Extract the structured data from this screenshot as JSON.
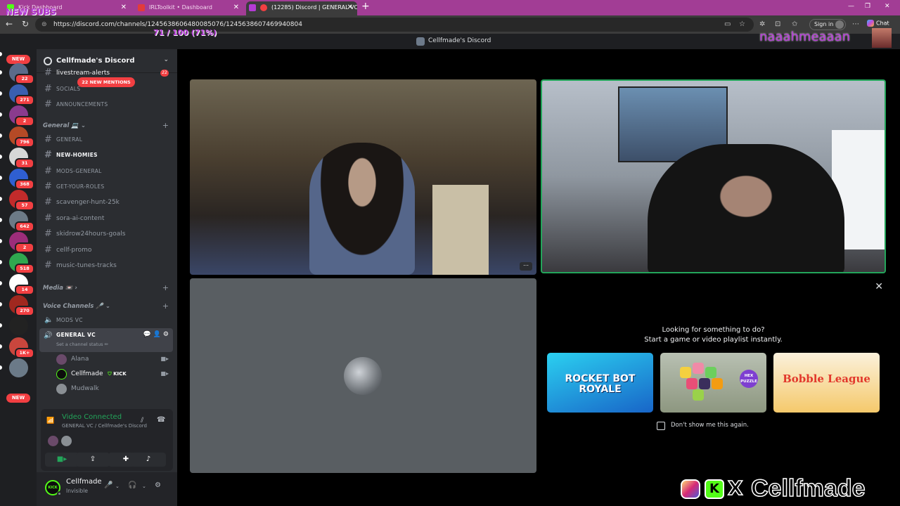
{
  "browser": {
    "tabs": [
      {
        "label": "Kick Dashboard",
        "active": false
      },
      {
        "label": "IRLToolkit • Dashboard",
        "active": false
      },
      {
        "label": "(12285) Discord | GENERAL VC",
        "active": true
      }
    ],
    "url": "https://discord.com/channels/1245638606480085076/1245638607469940804",
    "sign_in": "Sign in",
    "chat": "Chat"
  },
  "title_bar": {
    "title": "Cellfmade's Discord"
  },
  "guilds": [
    {
      "badge": "22",
      "color": "#5b6b8a"
    },
    {
      "badge": "271",
      "color": "#3a5fb0"
    },
    {
      "badge": "2",
      "color": "#8a3b8e"
    },
    {
      "badge": "796",
      "color": "#b54a26"
    },
    {
      "badge": "31",
      "color": "#d7d7d7"
    },
    {
      "badge": "368",
      "color": "#2f5fd1"
    },
    {
      "badge": "57",
      "color": "#c22b2b"
    },
    {
      "badge": "642",
      "color": "#6c7a86"
    },
    {
      "badge": "2",
      "color": "#9c2d7a"
    },
    {
      "badge": "518",
      "color": "#2fa84f"
    },
    {
      "badge": "14",
      "color": "#ffffff"
    },
    {
      "badge": "270",
      "color": "#a0281f"
    },
    {
      "badge": "",
      "color": "#222222"
    },
    {
      "badge": "1K+",
      "color": "#c9463d"
    },
    {
      "badge": "",
      "color": "#6b7a88"
    }
  ],
  "new_label": "NEW",
  "server": {
    "name": "Cellfmade's Discord",
    "mentions_pill": "22 NEW MENTIONS",
    "channels_top": [
      {
        "name": "livestream-alerts",
        "badge": "22",
        "small": false
      },
      {
        "name": "SOCIALS",
        "small": true
      },
      {
        "name": "ANNOUNCEMENTS",
        "small": true
      }
    ],
    "general_category": "General 💻",
    "general_channels": [
      {
        "name": "GENERAL",
        "small": true,
        "unread": false
      },
      {
        "name": "NEW-HOMIES",
        "small": true,
        "unread": true
      },
      {
        "name": "MODS-GENERAL",
        "small": true,
        "unread": false
      },
      {
        "name": "GET-YOUR-ROLES",
        "small": true,
        "unread": false
      },
      {
        "name": "scavenger-hunt-25k",
        "small": false,
        "unread": false
      },
      {
        "name": "sora-ai-content",
        "small": false,
        "unread": false
      },
      {
        "name": "skidrow24hours-goals",
        "small": false,
        "unread": false
      },
      {
        "name": "cellf-promo",
        "small": false,
        "unread": false
      },
      {
        "name": "music-tunes-tracks",
        "small": false,
        "unread": false
      }
    ],
    "media_category": "Media 📼",
    "voice_category": "Voice Channels 🎤",
    "mods_vc": "MODS VC",
    "general_vc": {
      "name": "GENERAL VC",
      "status": "Set a channel status ✏"
    },
    "members": [
      {
        "name": "Alana",
        "tag": ""
      },
      {
        "name": "Cellfmade",
        "tag": "KICK"
      },
      {
        "name": "Mudwalk",
        "tag": ""
      }
    ]
  },
  "connection": {
    "status": "Video Connected",
    "location": "GENERAL VC / Cellfmade's Discord"
  },
  "user": {
    "name": "Cellfmade",
    "status": "Invisible",
    "avatar_text": "KICK"
  },
  "activity": {
    "line1": "Looking for something to do?",
    "line2": "Start a game or video playlist instantly.",
    "cards": [
      {
        "title": "ROCKET BOT ROYALE"
      },
      {
        "title": "HEX PUZZLE"
      },
      {
        "title": "Bobble League"
      }
    ],
    "dont_show": "Don't show me this again."
  },
  "overlay": {
    "subs": "NEW SUBS",
    "goal": "71 / 100 (71%)",
    "webcam_name": "naaahmeaaan",
    "social_name": "Cellfmade"
  },
  "colors": {
    "accent": "#23a55a",
    "danger": "#f23f42",
    "kick": "#53fc18",
    "overlay": "#b43bd6"
  }
}
